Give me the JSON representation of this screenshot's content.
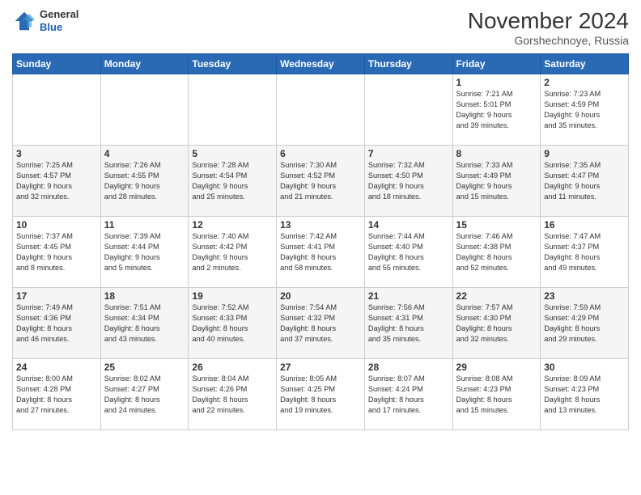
{
  "header": {
    "logo_general": "General",
    "logo_blue": "Blue",
    "month_title": "November 2024",
    "location": "Gorshechnoye, Russia"
  },
  "calendar": {
    "weekdays": [
      "Sunday",
      "Monday",
      "Tuesday",
      "Wednesday",
      "Thursday",
      "Friday",
      "Saturday"
    ],
    "weeks": [
      [
        {
          "day": "",
          "info": ""
        },
        {
          "day": "",
          "info": ""
        },
        {
          "day": "",
          "info": ""
        },
        {
          "day": "",
          "info": ""
        },
        {
          "day": "",
          "info": ""
        },
        {
          "day": "1",
          "info": "Sunrise: 7:21 AM\nSunset: 5:01 PM\nDaylight: 9 hours\nand 39 minutes."
        },
        {
          "day": "2",
          "info": "Sunrise: 7:23 AM\nSunset: 4:59 PM\nDaylight: 9 hours\nand 35 minutes."
        }
      ],
      [
        {
          "day": "3",
          "info": "Sunrise: 7:25 AM\nSunset: 4:57 PM\nDaylight: 9 hours\nand 32 minutes."
        },
        {
          "day": "4",
          "info": "Sunrise: 7:26 AM\nSunset: 4:55 PM\nDaylight: 9 hours\nand 28 minutes."
        },
        {
          "day": "5",
          "info": "Sunrise: 7:28 AM\nSunset: 4:54 PM\nDaylight: 9 hours\nand 25 minutes."
        },
        {
          "day": "6",
          "info": "Sunrise: 7:30 AM\nSunset: 4:52 PM\nDaylight: 9 hours\nand 21 minutes."
        },
        {
          "day": "7",
          "info": "Sunrise: 7:32 AM\nSunset: 4:50 PM\nDaylight: 9 hours\nand 18 minutes."
        },
        {
          "day": "8",
          "info": "Sunrise: 7:33 AM\nSunset: 4:49 PM\nDaylight: 9 hours\nand 15 minutes."
        },
        {
          "day": "9",
          "info": "Sunrise: 7:35 AM\nSunset: 4:47 PM\nDaylight: 9 hours\nand 11 minutes."
        }
      ],
      [
        {
          "day": "10",
          "info": "Sunrise: 7:37 AM\nSunset: 4:45 PM\nDaylight: 9 hours\nand 8 minutes."
        },
        {
          "day": "11",
          "info": "Sunrise: 7:39 AM\nSunset: 4:44 PM\nDaylight: 9 hours\nand 5 minutes."
        },
        {
          "day": "12",
          "info": "Sunrise: 7:40 AM\nSunset: 4:42 PM\nDaylight: 9 hours\nand 2 minutes."
        },
        {
          "day": "13",
          "info": "Sunrise: 7:42 AM\nSunset: 4:41 PM\nDaylight: 8 hours\nand 58 minutes."
        },
        {
          "day": "14",
          "info": "Sunrise: 7:44 AM\nSunset: 4:40 PM\nDaylight: 8 hours\nand 55 minutes."
        },
        {
          "day": "15",
          "info": "Sunrise: 7:46 AM\nSunset: 4:38 PM\nDaylight: 8 hours\nand 52 minutes."
        },
        {
          "day": "16",
          "info": "Sunrise: 7:47 AM\nSunset: 4:37 PM\nDaylight: 8 hours\nand 49 minutes."
        }
      ],
      [
        {
          "day": "17",
          "info": "Sunrise: 7:49 AM\nSunset: 4:36 PM\nDaylight: 8 hours\nand 46 minutes."
        },
        {
          "day": "18",
          "info": "Sunrise: 7:51 AM\nSunset: 4:34 PM\nDaylight: 8 hours\nand 43 minutes."
        },
        {
          "day": "19",
          "info": "Sunrise: 7:52 AM\nSunset: 4:33 PM\nDaylight: 8 hours\nand 40 minutes."
        },
        {
          "day": "20",
          "info": "Sunrise: 7:54 AM\nSunset: 4:32 PM\nDaylight: 8 hours\nand 37 minutes."
        },
        {
          "day": "21",
          "info": "Sunrise: 7:56 AM\nSunset: 4:31 PM\nDaylight: 8 hours\nand 35 minutes."
        },
        {
          "day": "22",
          "info": "Sunrise: 7:57 AM\nSunset: 4:30 PM\nDaylight: 8 hours\nand 32 minutes."
        },
        {
          "day": "23",
          "info": "Sunrise: 7:59 AM\nSunset: 4:29 PM\nDaylight: 8 hours\nand 29 minutes."
        }
      ],
      [
        {
          "day": "24",
          "info": "Sunrise: 8:00 AM\nSunset: 4:28 PM\nDaylight: 8 hours\nand 27 minutes."
        },
        {
          "day": "25",
          "info": "Sunrise: 8:02 AM\nSunset: 4:27 PM\nDaylight: 8 hours\nand 24 minutes."
        },
        {
          "day": "26",
          "info": "Sunrise: 8:04 AM\nSunset: 4:26 PM\nDaylight: 8 hours\nand 22 minutes."
        },
        {
          "day": "27",
          "info": "Sunrise: 8:05 AM\nSunset: 4:25 PM\nDaylight: 8 hours\nand 19 minutes."
        },
        {
          "day": "28",
          "info": "Sunrise: 8:07 AM\nSunset: 4:24 PM\nDaylight: 8 hours\nand 17 minutes."
        },
        {
          "day": "29",
          "info": "Sunrise: 8:08 AM\nSunset: 4:23 PM\nDaylight: 8 hours\nand 15 minutes."
        },
        {
          "day": "30",
          "info": "Sunrise: 8:09 AM\nSunset: 4:23 PM\nDaylight: 8 hours\nand 13 minutes."
        }
      ]
    ]
  }
}
